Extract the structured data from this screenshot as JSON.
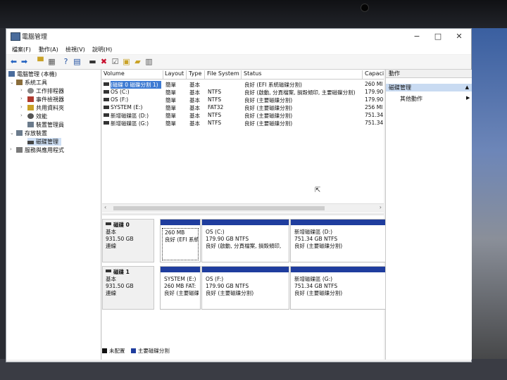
{
  "window": {
    "title": "電腦管理"
  },
  "menu": {
    "items": [
      "檔案(F)",
      "動作(A)",
      "檢視(V)",
      "說明(H)"
    ]
  },
  "toolbar": {
    "icons": [
      "back-arrow-icon",
      "forward-arrow-icon",
      "up-folder-icon",
      "show-hide-tree-icon",
      "help-icon",
      "properties-icon",
      "connect-icon",
      "delete-icon",
      "checklist-icon",
      "open-icon",
      "folder-icon",
      "settings-icon"
    ]
  },
  "tree": {
    "root": "電腦管理 (本機)",
    "system_tools": "系統工具",
    "task_scheduler": "工作排程器",
    "event_viewer": "事件檢視器",
    "shared_folders": "共用資料夾",
    "performance": "效能",
    "device_manager": "裝置管理員",
    "storage": "存放裝置",
    "disk_management": "磁碟管理",
    "services_apps": "服務與應用程式"
  },
  "volumes": {
    "headers": {
      "volume": "Volume",
      "layout": "Layout",
      "type": "Type",
      "fs": "File System",
      "status": "Status",
      "capacity": "Capaci"
    },
    "rows": [
      {
        "volume": "(磁碟 0 磁碟分割 1)",
        "layout": "簡單",
        "type": "基本",
        "fs": "",
        "status": "良好 (EFI 系統磁碟分割)",
        "capacity": "260 MI"
      },
      {
        "volume": "OS (C:)",
        "layout": "簡單",
        "type": "基本",
        "fs": "NTFS",
        "status": "良好 (啟動, 分頁檔案, 損毀傾印, 主要磁碟分割)",
        "capacity": "179.90"
      },
      {
        "volume": "OS (F:)",
        "layout": "簡單",
        "type": "基本",
        "fs": "NTFS",
        "status": "良好 (主要磁碟分割)",
        "capacity": "179.90"
      },
      {
        "volume": "SYSTEM (E:)",
        "layout": "簡單",
        "type": "基本",
        "fs": "FAT32",
        "status": "良好 (主要磁碟分割)",
        "capacity": "256 MI"
      },
      {
        "volume": "新增磁碟區 (D:)",
        "layout": "簡單",
        "type": "基本",
        "fs": "NTFS",
        "status": "良好 (主要磁碟分割)",
        "capacity": "751.34"
      },
      {
        "volume": "新增磁碟區 (G:)",
        "layout": "簡單",
        "type": "基本",
        "fs": "NTFS",
        "status": "良好 (主要磁碟分割)",
        "capacity": "751.34"
      }
    ]
  },
  "disks": [
    {
      "name": "磁碟 0",
      "kind": "基本",
      "size": "931.50 GB",
      "state": "連線",
      "partitions": [
        {
          "title": "",
          "size": "260 MB",
          "status": "良好 (EFI 系統"
        },
        {
          "title": "OS (C:)",
          "size": "179.90 GB NTFS",
          "status": "良好 (啟動, 分頁檔案, 損毀傾印,"
        },
        {
          "title": "新增磁碟區 (D:)",
          "size": "751.34 GB NTFS",
          "status": "良好 (主要磁碟分割)"
        }
      ]
    },
    {
      "name": "磁碟 1",
      "kind": "基本",
      "size": "931.50 GB",
      "state": "連線",
      "partitions": [
        {
          "title": "SYSTEM (E:)",
          "size": "260 MB FAT:",
          "status": "良好 (主要磁碟"
        },
        {
          "title": "OS (F:)",
          "size": "179.90 GB NTFS",
          "status": "良好 (主要磁碟分割)"
        },
        {
          "title": "新增磁碟區 (G:)",
          "size": "751.34 GB NTFS",
          "status": "良好 (主要磁碟分割)"
        }
      ]
    }
  ],
  "legend": {
    "unallocated": "未配置",
    "primary": "主要磁碟分割",
    "unallocated_color": "#111111",
    "primary_color": "#1f3d9e"
  },
  "actions": {
    "header": "動作",
    "section": "磁碟管理",
    "more": "其他動作"
  }
}
